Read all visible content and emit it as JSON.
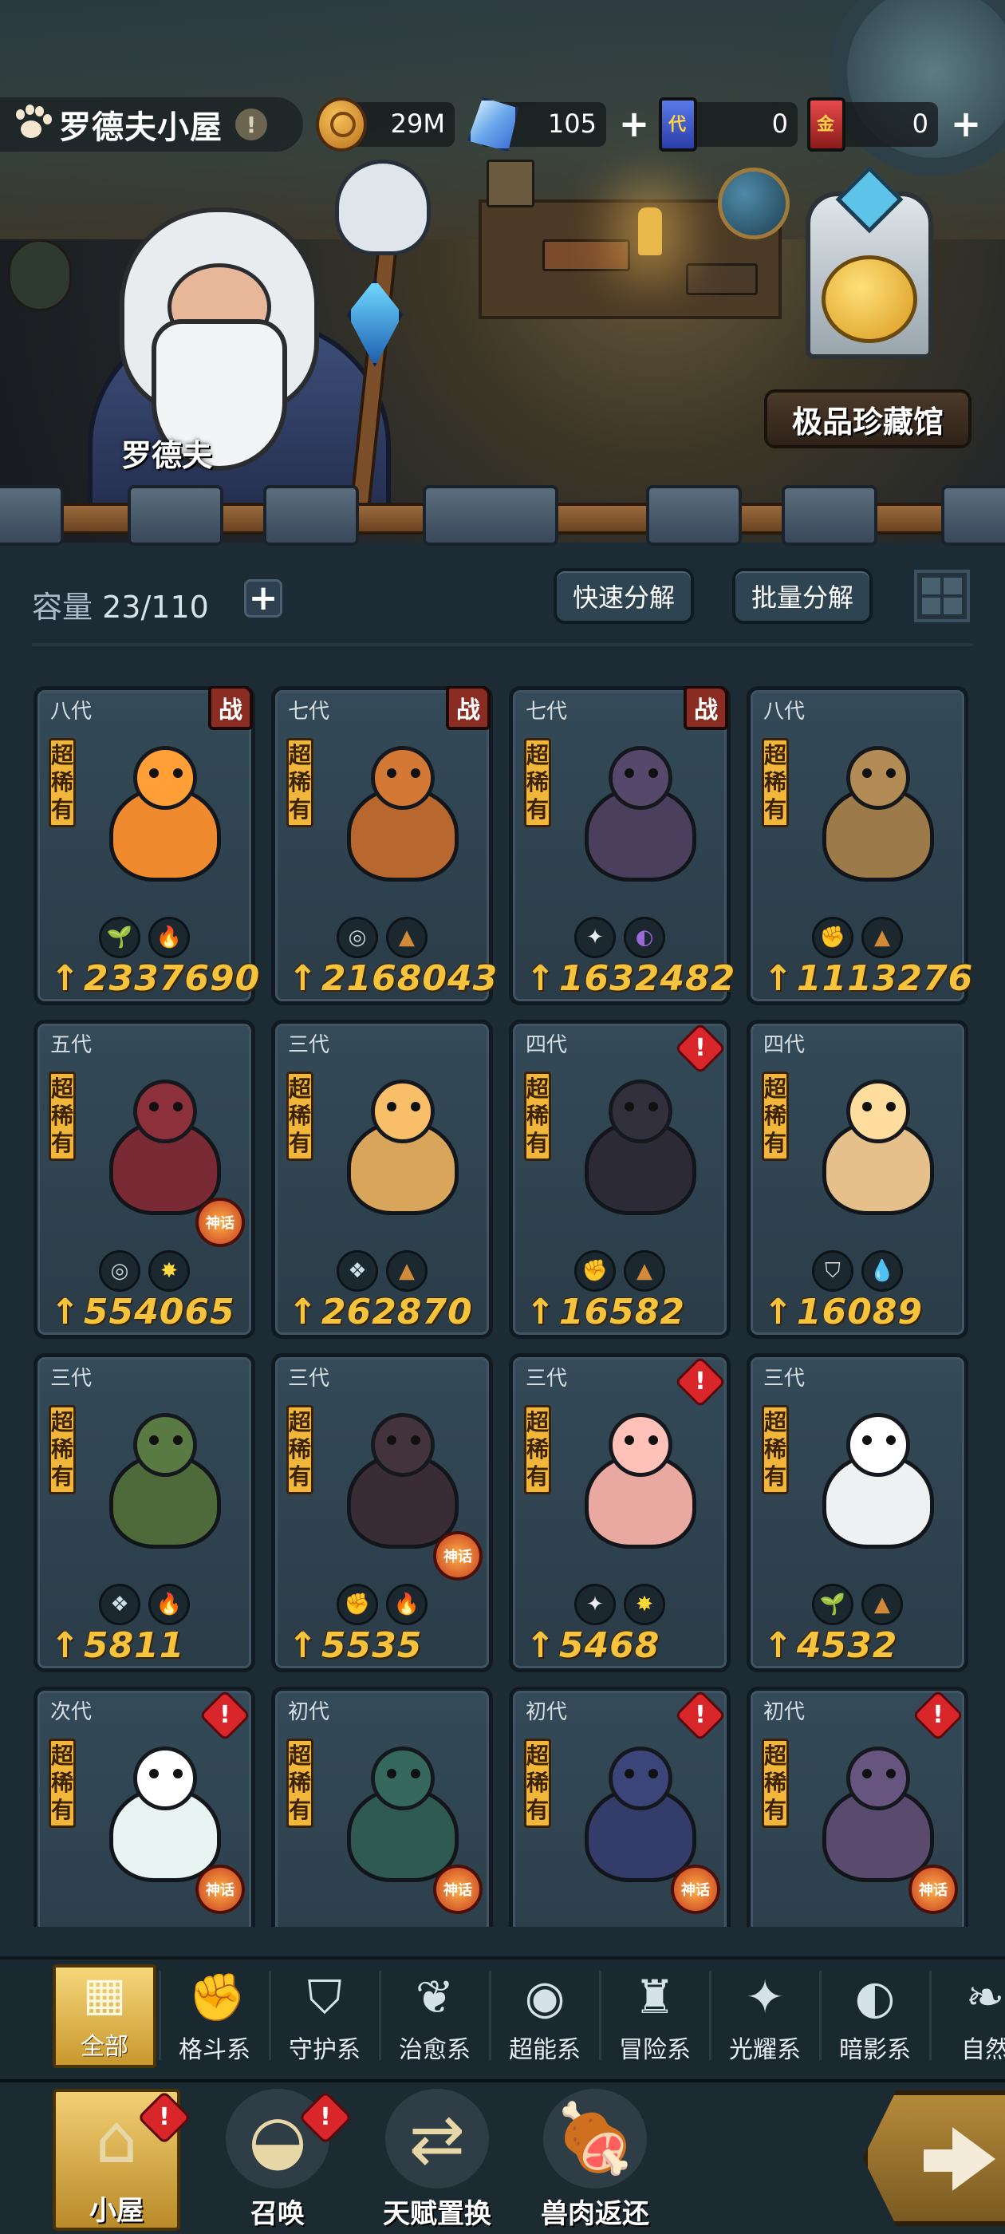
{
  "header": {
    "title": "罗德夫小屋",
    "info_icon": "!",
    "resources": [
      {
        "name": "coin",
        "value": "29M",
        "has_plus": false
      },
      {
        "name": "crystal",
        "value": "105",
        "has_plus": true
      },
      {
        "name": "blue-card",
        "icon_text": "代",
        "value": "0",
        "has_plus": false
      },
      {
        "name": "red-card",
        "icon_text": "金",
        "value": "0",
        "has_plus": true
      }
    ],
    "plus_symbol": "+"
  },
  "scene": {
    "npc_name": "罗德夫",
    "treasury_label": "极品珍藏馆"
  },
  "storage": {
    "capacity_label": "容量",
    "capacity_value": "23/110",
    "plus_symbol": "+",
    "quick_decompose": "快速分解",
    "batch_decompose": "批量分解"
  },
  "rarity_text": "超稀有",
  "battle_badge": "战",
  "alert_text": "!",
  "skill_tag_text": "神话",
  "power_arrow": "↑",
  "pets": [
    {
      "gen": "八代",
      "badge": "battle",
      "power": "2337690",
      "elements": [
        "治愈",
        "火"
      ],
      "color": "#f08a2e"
    },
    {
      "gen": "七代",
      "badge": "battle",
      "power": "2168043",
      "elements": [
        "超能",
        "土"
      ],
      "color": "#b8682e"
    },
    {
      "gen": "七代",
      "badge": "battle",
      "power": "1632482",
      "elements": [
        "光耀",
        "暗影"
      ],
      "color": "#4a3f5c"
    },
    {
      "gen": "八代",
      "badge": "none",
      "power": "1113276",
      "elements": [
        "格斗",
        "土"
      ],
      "color": "#9c7a4a"
    },
    {
      "gen": "五代",
      "badge": "none",
      "power": "554065",
      "elements": [
        "超能",
        "光"
      ],
      "color": "#7a2a34"
    },
    {
      "gen": "三代",
      "badge": "none",
      "power": "262870",
      "elements": [
        "冒险",
        "土"
      ],
      "color": "#d8a55a"
    },
    {
      "gen": "四代",
      "badge": "alert",
      "power": "16582",
      "elements": [
        "格斗",
        "土"
      ],
      "color": "#2c2a36"
    },
    {
      "gen": "四代",
      "badge": "none",
      "power": "16089",
      "elements": [
        "守护",
        "水"
      ],
      "color": "#e6c08a"
    },
    {
      "gen": "三代",
      "badge": "none",
      "power": "5811",
      "elements": [
        "冒险",
        "火"
      ],
      "color": "#4e6a3a"
    },
    {
      "gen": "三代",
      "badge": "none",
      "power": "5535",
      "elements": [
        "格斗",
        "火"
      ],
      "color": "#3a2c34"
    },
    {
      "gen": "三代",
      "badge": "alert",
      "power": "5468",
      "elements": [
        "光耀",
        "光"
      ],
      "color": "#e9a8a0"
    },
    {
      "gen": "三代",
      "badge": "none",
      "power": "4532",
      "elements": [
        "治愈",
        "土"
      ],
      "color": "#eef0f2"
    },
    {
      "gen": "次代",
      "badge": "alert",
      "power": "",
      "elements": [],
      "color": "#e8f4f2"
    },
    {
      "gen": "初代",
      "badge": "none",
      "power": "",
      "elements": [],
      "color": "#2f5a52"
    },
    {
      "gen": "初代",
      "badge": "alert",
      "power": "",
      "elements": [],
      "color": "#343c6a"
    },
    {
      "gen": "初代",
      "badge": "alert",
      "power": "",
      "elements": [],
      "color": "#5a4a6e"
    }
  ],
  "categories": [
    {
      "label": "全部",
      "icon": "all-blocks-icon",
      "active": true
    },
    {
      "label": "格斗系",
      "icon": "fist-icon",
      "active": false
    },
    {
      "label": "守护系",
      "icon": "shield-icon",
      "active": false
    },
    {
      "label": "治愈系",
      "icon": "sprout-icon",
      "active": false
    },
    {
      "label": "超能系",
      "icon": "alien-icon",
      "active": false
    },
    {
      "label": "冒险系",
      "icon": "lantern-icon",
      "active": false
    },
    {
      "label": "光耀系",
      "icon": "star-cross-icon",
      "active": false
    },
    {
      "label": "暗影系",
      "icon": "eye-icon",
      "active": false
    },
    {
      "label": "自然",
      "icon": "leaf-icon",
      "active": false
    }
  ],
  "nav": [
    {
      "label": "小屋",
      "icon": "house-icon",
      "active": true,
      "alert": true
    },
    {
      "label": "召唤",
      "icon": "egg-icon",
      "active": false,
      "alert": true
    },
    {
      "label": "天赋置换",
      "icon": "swap-icon",
      "active": false,
      "alert": false
    },
    {
      "label": "兽肉返还",
      "icon": "meat-icon",
      "active": false,
      "alert": false
    }
  ],
  "colors": {
    "panel_bg": "#1d2b34",
    "card_bg": "#344a58",
    "power_gold": "#f6c43c",
    "rarity_gold": "#f2b63a",
    "alert_red": "#d8262b",
    "battle_badge": "#8a2c22",
    "active_tab_gold": "#e9c25a"
  }
}
